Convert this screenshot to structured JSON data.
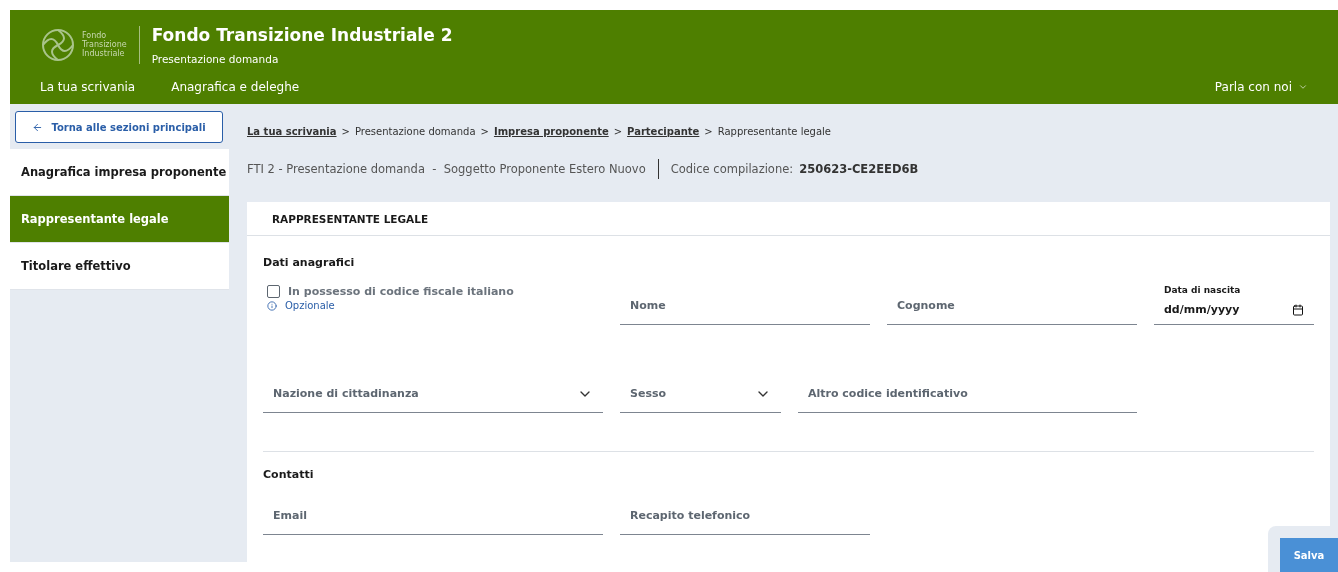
{
  "header": {
    "logo_text": [
      "Fondo",
      "Transizione",
      "Industriale"
    ],
    "title": "Fondo Transizione Industriale 2",
    "subtitle": "Presentazione domanda",
    "nav": [
      {
        "label": "La tua scrivania"
      },
      {
        "label": "Anagrafica e deleghe"
      }
    ],
    "contact": "Parla con noi"
  },
  "sidebar": {
    "back_button": "Torna alle sezioni principali",
    "items": [
      {
        "label": "Anagrafica impresa proponente",
        "selected": false
      },
      {
        "label": "Rappresentante legale",
        "selected": true
      },
      {
        "label": "Titolare effettivo",
        "selected": false
      }
    ]
  },
  "breadcrumb": {
    "separator": ">",
    "items": [
      {
        "label": "La tua scrivania",
        "link": true
      },
      {
        "label": "Presentazione domanda",
        "link": false
      },
      {
        "label": "Impresa proponente",
        "link": true
      },
      {
        "label": "Partecipante",
        "link": true
      },
      {
        "label": "Rappresentante legale",
        "link": false
      }
    ]
  },
  "info": {
    "text": "FTI 2 - Presentazione domanda  -  Soggetto Proponente Estero Nuovo",
    "code_label": "Codice compilazione:",
    "code": "250623-CE2EED6B"
  },
  "panel": {
    "title": "RAPPRESENTANTE LEGALE",
    "sections": [
      {
        "title": "Dati anagrafici",
        "rows": [
          [
            {
              "kind": "checkbox",
              "label": "In possesso di codice fiscale italiano",
              "checked": false,
              "hint": "Opzionale"
            },
            {
              "kind": "text",
              "placeholder": "Nome"
            },
            {
              "kind": "text",
              "placeholder": "Cognome"
            },
            {
              "kind": "date",
              "label": "Data di nascita",
              "placeholder": "dd/mm/yyyy"
            }
          ],
          [
            {
              "kind": "select",
              "placeholder": "Nazione di cittadinanza"
            },
            {
              "kind": "select",
              "placeholder": "Sesso"
            },
            {
              "kind": "text",
              "placeholder": "Altro codice identificativo"
            }
          ]
        ]
      },
      {
        "title": "Contatti",
        "rows": [
          [
            {
              "kind": "text",
              "placeholder": "Email"
            },
            {
              "kind": "text",
              "placeholder": "Recapito telefonico"
            }
          ]
        ]
      }
    ]
  },
  "save_button": "Salva"
}
